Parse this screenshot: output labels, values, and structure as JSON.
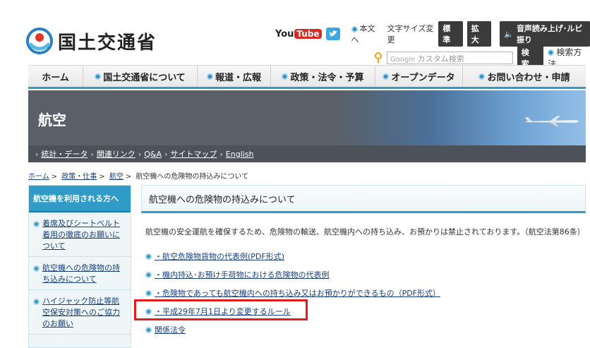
{
  "header": {
    "logo_text": "国土交通省",
    "youtube_you": "You",
    "youtube_tube": "Tube",
    "main_text_link": "本文へ",
    "font_size_label": "文字サイズ変更",
    "font_standard": "標 準",
    "font_large": "拡 大",
    "speech_button": "音声読み上げ･ルビ振り",
    "search_prefix": "Google",
    "search_placeholder": "カスタム検索",
    "search_button": "検 索",
    "search_method": "検索方法"
  },
  "gnav": {
    "items": [
      "ホーム",
      "国土交通省について",
      "報道・広報",
      "政策・法令・予算",
      "オープンデータ",
      "お問い合わせ・申請"
    ]
  },
  "banner": {
    "title": "航空"
  },
  "subnav": {
    "items": [
      "統計・データ",
      "関連リンク",
      "Q&A",
      "サイトマップ",
      "English"
    ]
  },
  "breadcrumb": {
    "home": "ホーム",
    "policy": "政策・仕事",
    "aviation": "航空",
    "current": "航空機への危険物の持込みについて"
  },
  "sidebar": {
    "heading": "航空機を利用される方へ",
    "items": [
      "着席及びシートベルト着用の徹底のお願いについて",
      "航空機への危険物の持ち込みについて",
      "ハイジャック防止等航空保安対策へのご協力のお願い"
    ]
  },
  "main": {
    "title": "航空機への危険物の持込みについて",
    "intro": "航空機の安全運航を確保するため、危険物の輸送、航空機内への持ち込み、お預かりは禁止されております。（航空法第86条）",
    "links": [
      "・航空危険物貨物の代表例(PDF形式)",
      "・機内持込･お預け手荷物における危険物の代表例",
      "・危険物であっても航空機内への持ち込み又はお預かりができるもの（PDF形式）",
      "・平成29年7月1日より変更するルール",
      "関係法令"
    ]
  },
  "colors": {
    "accent": "#2f9bc6",
    "banner": "#5a6068",
    "highlight": "#e31c1c"
  }
}
